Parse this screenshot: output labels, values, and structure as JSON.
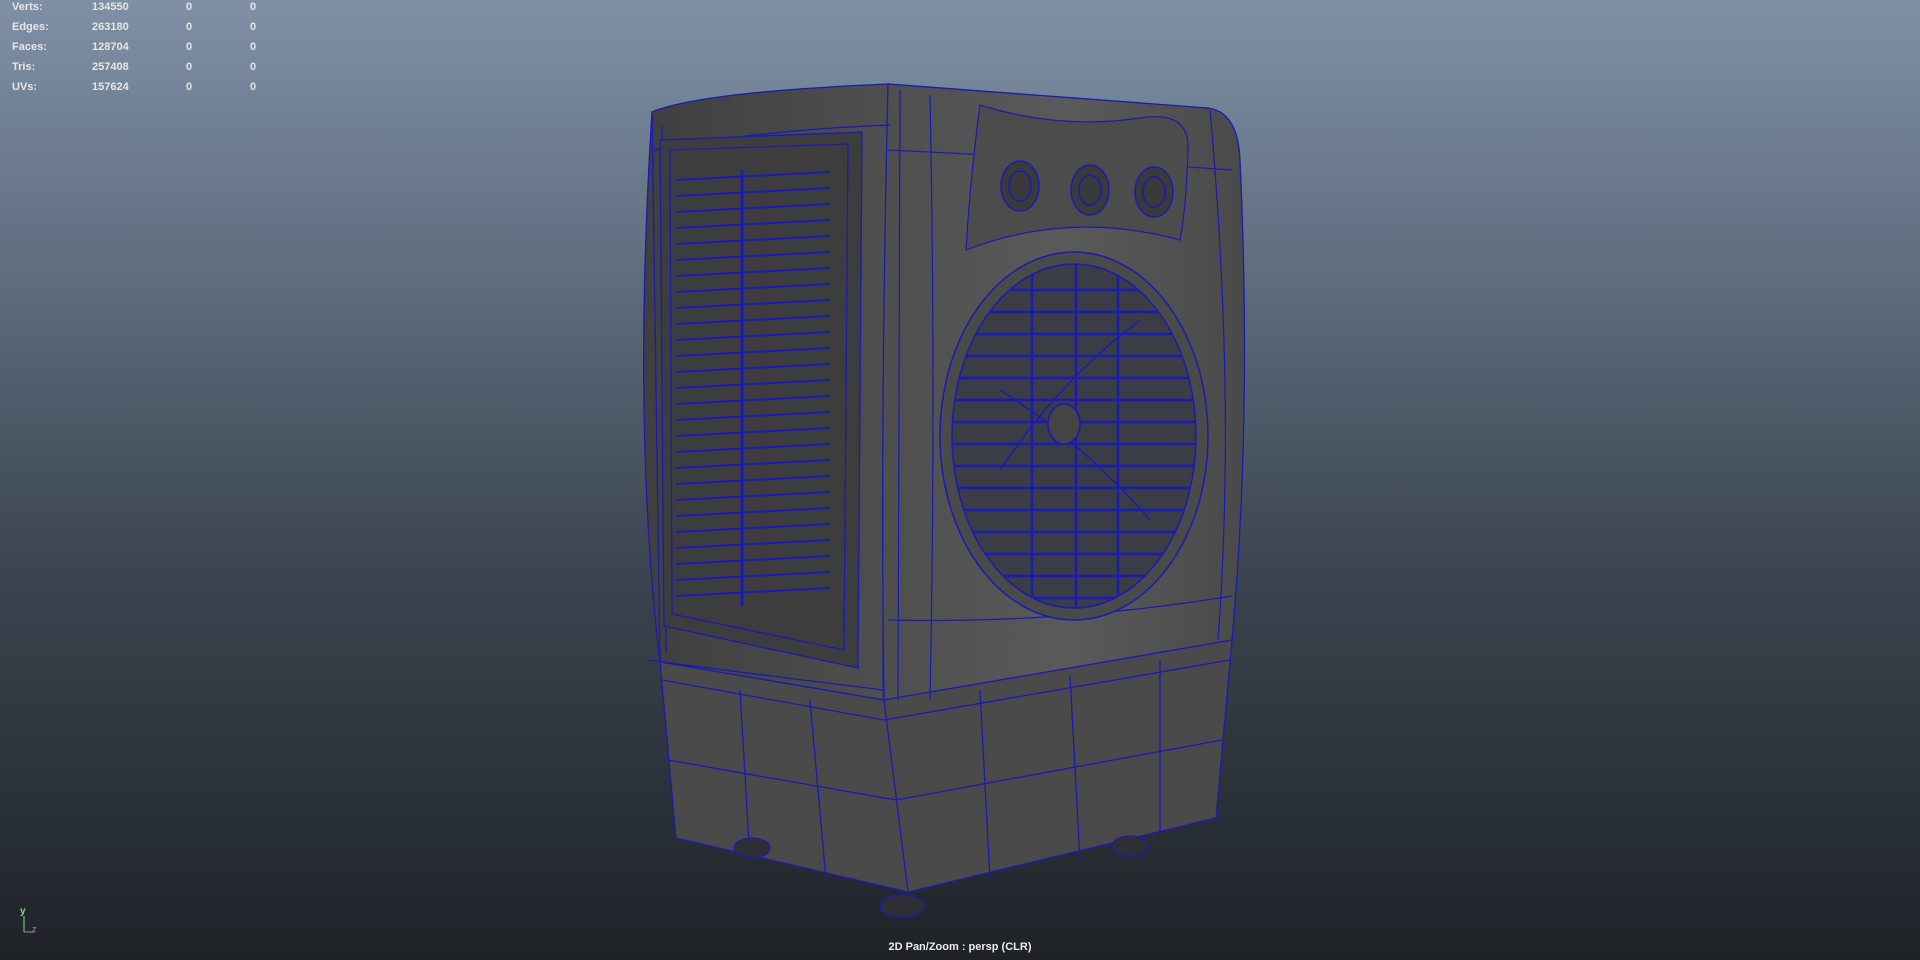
{
  "heads_up": {
    "rows": [
      {
        "label": "Verts:",
        "v1": "134550",
        "v2": "0",
        "v3": "0"
      },
      {
        "label": "Edges:",
        "v1": "263180",
        "v2": "0",
        "v3": "0"
      },
      {
        "label": "Faces:",
        "v1": "128704",
        "v2": "0",
        "v3": "0"
      },
      {
        "label": "Tris:",
        "v1": "257408",
        "v2": "0",
        "v3": "0"
      },
      {
        "label": "UVs:",
        "v1": "157624",
        "v2": "0",
        "v3": "0"
      }
    ]
  },
  "viewport": {
    "status_text": "2D Pan/Zoom : persp (CLR)",
    "wireframe_color": "#1a1ab4",
    "shade_color": "#555555",
    "background_top": "#7f90a6",
    "background_bottom": "#1f2328"
  },
  "axis_indicator": {
    "y_label": "y",
    "z_label": "z"
  }
}
